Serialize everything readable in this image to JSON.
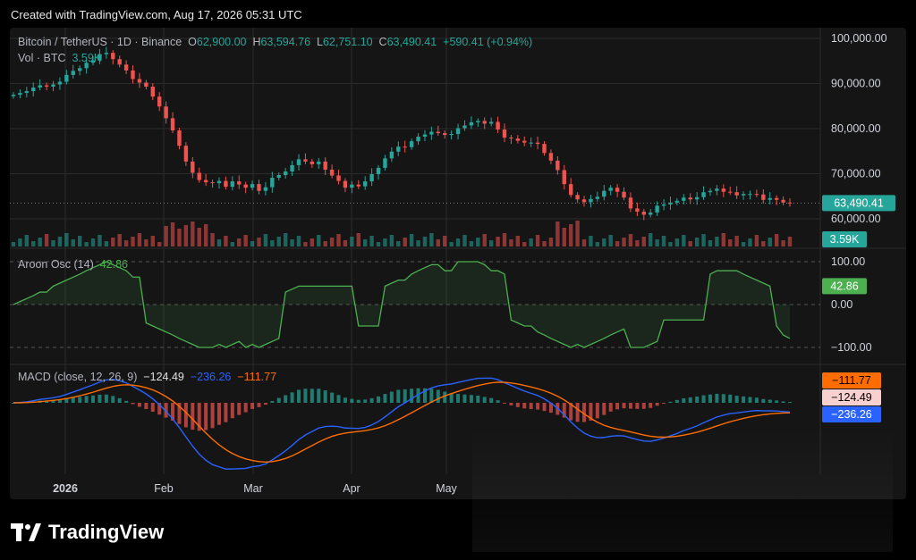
{
  "header": {
    "created": "Created with TradingView.com, Aug 17, 2026 05:31 UTC"
  },
  "legend": {
    "symbol": "Bitcoin / TetherUS · 1D · Binance",
    "o_label": "O",
    "o_value": "62,900.00",
    "h_label": "H",
    "h_value": "63,594.76",
    "l_label": "L",
    "l_value": "62,751.10",
    "c_label": "C",
    "c_value": "63,490.41",
    "change": "+590.41 (+0.94%)",
    "vol_label": "Vol · BTC",
    "vol_value": "3.59K",
    "aroon_label": "Aroon Osc (14)",
    "aroon_value": "42.86",
    "macd_label": "MACD (close, 12, 26, 9)",
    "macd_v1": "−124.49",
    "macd_v2": "−236.26",
    "macd_v3": "−111.77"
  },
  "brand": {
    "logo_text": "TradingView"
  },
  "colors": {
    "up": "#26a69a",
    "down": "#ef5350",
    "macd": "#2962ff",
    "signal": "#ff6d00",
    "aroon": "#4caf50"
  },
  "chart_data": {
    "type": "candlestick",
    "price_axis": {
      "ticks": [
        {
          "label": "100,000.00",
          "v": 100000
        },
        {
          "label": "90,000.00",
          "v": 90000
        },
        {
          "label": "80,000.00",
          "v": 80000
        },
        {
          "label": "70,000.00",
          "v": 70000
        },
        {
          "label": "60,000.00",
          "v": 60000
        }
      ],
      "last_price": "63,490.41",
      "last_value": 63490.41
    },
    "volume": {
      "last": "3.59K"
    },
    "time_axis": [
      "2026",
      "Feb",
      "Mar",
      "Apr",
      "May"
    ],
    "close_series": [
      87500,
      87900,
      88300,
      89100,
      89600,
      89300,
      89800,
      90400,
      91900,
      92800,
      93400,
      94600,
      95100,
      96500,
      96800,
      95400,
      94200,
      92900,
      91000,
      90200,
      89300,
      87100,
      84900,
      82300,
      79600,
      76200,
      72700,
      70200,
      68600,
      68100,
      67900,
      68400,
      67100,
      68300,
      67600,
      66900,
      67700,
      66200,
      67000,
      69100,
      69700,
      70500,
      71900,
      73200,
      72700,
      72100,
      72700,
      70900,
      69600,
      68400,
      66900,
      67600,
      67200,
      68300,
      69900,
      71300,
      73400,
      74900,
      76000,
      75900,
      77200,
      78200,
      78700,
      79300,
      79000,
      78600,
      78800,
      80100,
      80700,
      81400,
      81700,
      81100,
      81500,
      79800,
      78000,
      77800,
      77300,
      76900,
      76900,
      76600,
      74600,
      72900,
      70800,
      67700,
      65300,
      64300,
      63700,
      64400,
      64900,
      66200,
      66900,
      66000,
      64700,
      62300,
      61600,
      60900,
      61400,
      62900,
      63200,
      63600,
      64000,
      64700,
      64300,
      64800,
      65900,
      66200,
      66700,
      66000,
      65900,
      65200,
      65500,
      65500,
      65400,
      64200,
      64600,
      64200,
      63600,
      63490
    ],
    "aroon_axis": [
      {
        "label": "100.00",
        "v": 100
      },
      {
        "label": "0.00",
        "v": 0
      },
      {
        "label": "−100.00",
        "v": -100
      }
    ],
    "aroon_last": "42.86",
    "macd": {
      "macd_last": "−236.26",
      "signal_last": "−111.77",
      "hist_last": "−124.49"
    }
  }
}
